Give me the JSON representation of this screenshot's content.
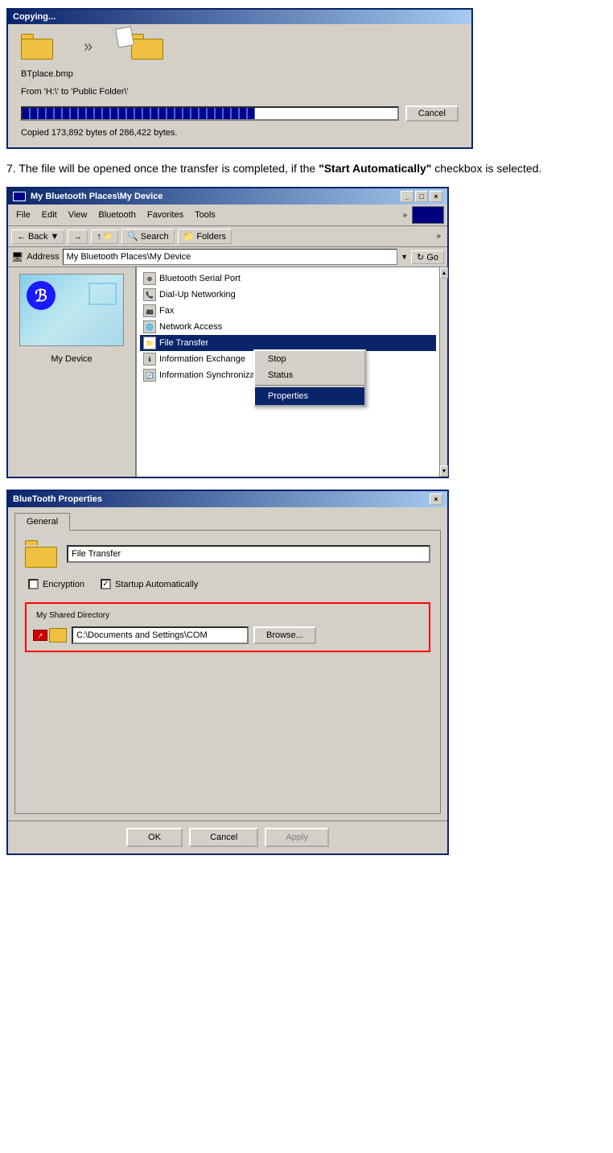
{
  "copying_dialog": {
    "title": "Copying...",
    "filename": "BTplace.bmp",
    "from_to": "From 'H:\\' to 'Public Folder\\'",
    "copied_status": "Copied 173,892 bytes of 286,422 bytes.",
    "cancel_label": "Cancel",
    "progress_percent": 62
  },
  "instruction": {
    "text_before": "7. The file will be opened once the transfer is completed, if the ",
    "bold_text": "\"Start Automatically\"",
    "text_after": " checkbox is selected."
  },
  "browser_window": {
    "title": "My Bluetooth Places\\My Device",
    "menu_items": [
      "File",
      "Edit",
      "View",
      "Bluetooth",
      "Favorites",
      "Tools"
    ],
    "back_label": "Back",
    "search_label": "Search",
    "folders_label": "Folders",
    "address_label": "Address",
    "address_value": "My Bluetooth Places\\My Device",
    "go_label": "Go",
    "left_pane_label": "My Device",
    "services": [
      {
        "name": "Bluetooth Serial Port",
        "icon": "serial"
      },
      {
        "name": "Dial-Up Networking",
        "icon": "network"
      },
      {
        "name": "Fax",
        "icon": "fax"
      },
      {
        "name": "Network Access",
        "icon": "network"
      },
      {
        "name": "File Transfer",
        "icon": "file",
        "selected": true
      },
      {
        "name": "Information Exchange",
        "icon": "info"
      },
      {
        "name": "Information Synchronization",
        "icon": "sync"
      }
    ],
    "titlebar_buttons": [
      "_",
      "□",
      "×"
    ]
  },
  "context_menu": {
    "items": [
      "Stop",
      "Status"
    ],
    "highlighted_item": "Properties"
  },
  "bt_properties": {
    "title": "BlueTooth Properties",
    "tab_label": "General",
    "name_value": "File Transfer",
    "encryption_label": "Encryption",
    "encryption_checked": false,
    "startup_label": "Startup Automatically",
    "startup_checked": true,
    "shared_dir_group_label": "My Shared Directory",
    "dir_value": "C:\\Documents and Settings\\COM",
    "browse_label": "Browse...",
    "ok_label": "OK",
    "cancel_label": "Cancel",
    "apply_label": "Apply",
    "titlebar_button": "×"
  }
}
